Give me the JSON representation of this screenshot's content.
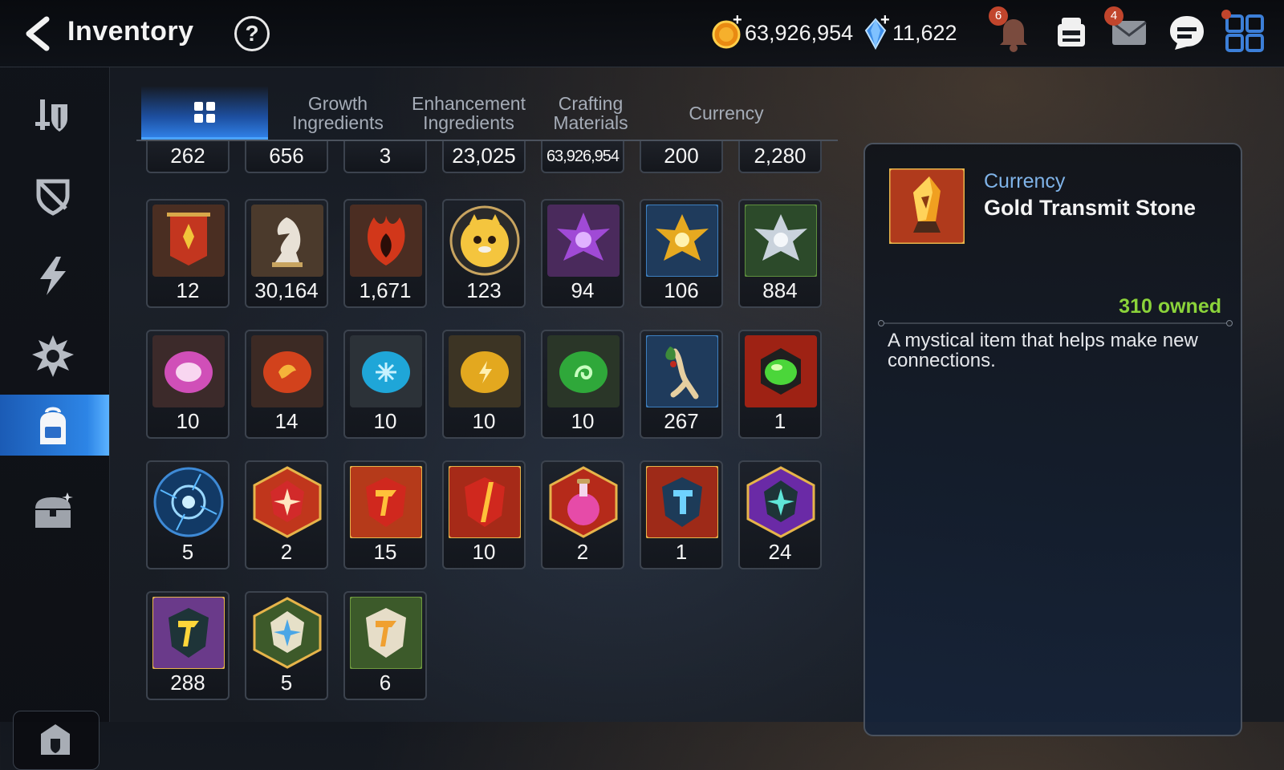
{
  "header": {
    "title": "Inventory",
    "help_icon": "question-circle-icon",
    "gold": "63,926,954",
    "crystal": "11,622",
    "plus_symbol": "+",
    "notifications_badge": "6",
    "mail_badge": "4"
  },
  "sidebar": {
    "items": [
      {
        "icon": "armor-sword-icon"
      },
      {
        "icon": "broken-shield-icon"
      },
      {
        "icon": "lightning-icon"
      },
      {
        "icon": "spiky-gear-icon"
      },
      {
        "icon": "backpack-icon",
        "active": true
      },
      {
        "icon": "treasure-chest-icon"
      }
    ],
    "bottom_icon": "castle-shield-icon"
  },
  "tabs": [
    {
      "label": "",
      "icon": "grid-icon",
      "active": true
    },
    {
      "label": "Growth Ingredients"
    },
    {
      "label": "Enhancement Ingredients"
    },
    {
      "label": "Crafting Materials"
    },
    {
      "label": "Currency"
    }
  ],
  "grid": {
    "top_partial_row": [
      "262",
      "656",
      "3",
      "23,025",
      "63,926,954",
      "200",
      "2,280"
    ],
    "rows": [
      [
        {
          "count": "12",
          "icon": "red-banner-icon"
        },
        {
          "count": "30,164",
          "icon": "white-horse-icon"
        },
        {
          "count": "1,671",
          "icon": "fire-leaf-icon"
        },
        {
          "count": "123",
          "icon": "yellow-mascot-icon"
        },
        {
          "count": "94",
          "icon": "purple-flower-icon"
        },
        {
          "count": "106",
          "icon": "gold-flower-icon"
        },
        {
          "count": "884",
          "icon": "silver-flower-icon"
        }
      ],
      [
        {
          "count": "10",
          "icon": "pink-rune-icon"
        },
        {
          "count": "14",
          "icon": "red-rune-icon"
        },
        {
          "count": "10",
          "icon": "blue-rune-icon"
        },
        {
          "count": "10",
          "icon": "gold-rune-icon"
        },
        {
          "count": "10",
          "icon": "green-rune-icon"
        },
        {
          "count": "267",
          "icon": "ginseng-root-icon"
        },
        {
          "count": "1",
          "icon": "green-gem-icon"
        }
      ],
      [
        {
          "count": "5",
          "icon": "blue-portal-icon"
        },
        {
          "count": "2",
          "icon": "red-star-stone-icon"
        },
        {
          "count": "15",
          "icon": "red-transmit-stone-icon"
        },
        {
          "count": "10",
          "icon": "red-crystal-stone-icon"
        },
        {
          "count": "2",
          "icon": "pink-potion-icon"
        },
        {
          "count": "1",
          "icon": "blue-hammer-stone-icon"
        },
        {
          "count": "24",
          "icon": "purple-star-stone-icon"
        }
      ],
      [
        {
          "count": "288",
          "icon": "purple-transmit-stone-icon"
        },
        {
          "count": "5",
          "icon": "white-star-stone-icon"
        },
        {
          "count": "6",
          "icon": "green-transmit-stone-icon"
        }
      ]
    ]
  },
  "detail": {
    "category": "Currency",
    "name": "Gold Transmit Stone",
    "owned": "310 owned",
    "description": "A mystical item that helps make new connections.",
    "icon": "gold-transmit-stone-icon"
  },
  "colors": {
    "accent_blue": "#2f7fe5",
    "owned_green": "#8bd33a",
    "category_blue": "#7fb3e8",
    "badge_red": "#c1452c"
  }
}
